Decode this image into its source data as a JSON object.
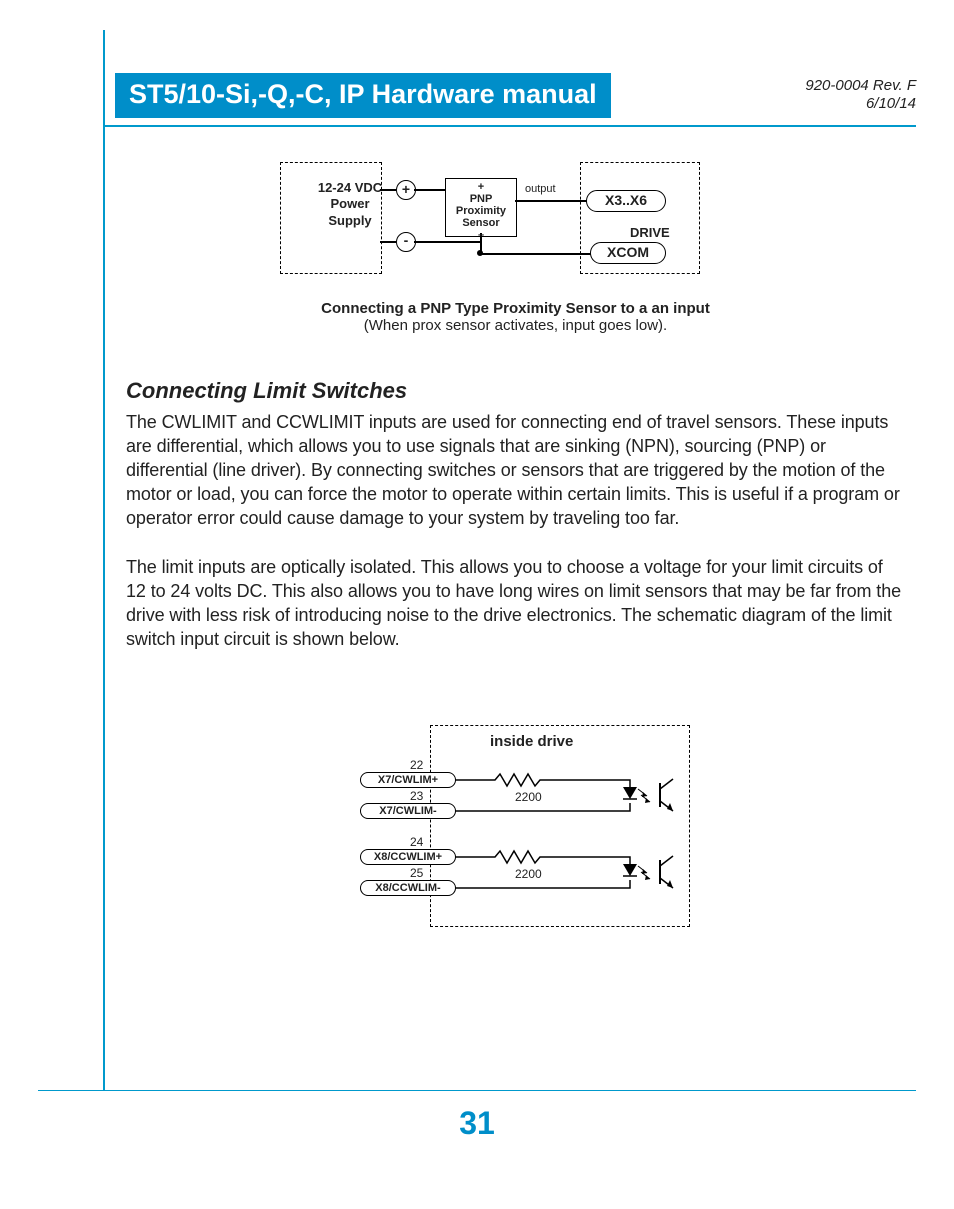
{
  "header": {
    "title": "ST5/10-Si,-Q,-C, IP Hardware manual",
    "rev": "920-0004 Rev. F",
    "date": "6/10/14"
  },
  "diagram1": {
    "power_supply_label": "12-24 VDC Power Supply",
    "plus": "+",
    "minus": "-",
    "sensor_plus": "+",
    "sensor_label": "PNP Proximity Sensor",
    "sensor_minus": "–",
    "output_label": "output",
    "x3x6": "X3..X6",
    "drive": "DRIVE",
    "xcom": "XCOM",
    "caption_bold": "Connecting a PNP Type Proximity Sensor to a an input",
    "caption_sub": "(When prox sensor activates, input goes low)."
  },
  "section": {
    "heading": "Connecting Limit Switches",
    "p1": "The CWLIMIT and CCWLIMIT inputs are used for connecting end of travel sensors.  These inputs are differential, which allows you to use signals that are sinking (NPN), sourcing (PNP) or differential (line driver).  By connecting switches or sensors that are triggered by the motion of the motor or load, you can force the motor to operate within certain limits.  This is useful if a program or operator error could cause damage to your system by traveling too far.",
    "p2": "The limit inputs are optically isolated.  This allows you to choose a voltage for your limit circuits of 12 to 24 volts DC.  This also allows you to have long wires on limit sensors that may be far from the drive with less risk of introducing noise to the drive electronics.  The schematic diagram of the limit switch input circuit is shown below."
  },
  "diagram2": {
    "inside_label": "inside drive",
    "pins": [
      {
        "num": "22",
        "name": "X7/CWLIM+"
      },
      {
        "num": "23",
        "name": "X7/CWLIM-"
      },
      {
        "num": "24",
        "name": "X8/CCWLIM+"
      },
      {
        "num": "25",
        "name": "X8/CCWLIM-"
      }
    ],
    "res": "2200"
  },
  "page_number": "31"
}
